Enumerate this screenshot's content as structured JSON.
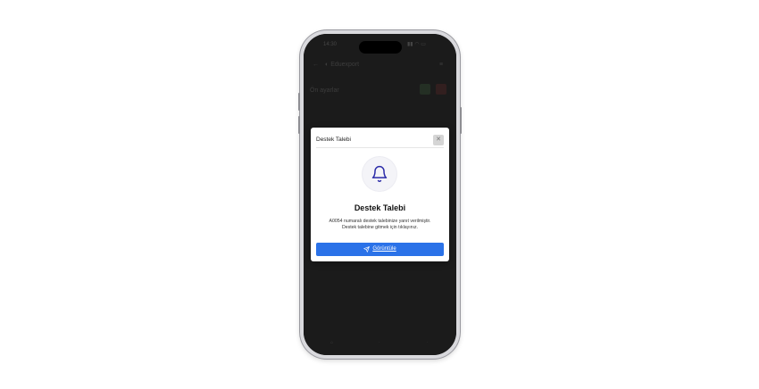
{
  "status_bar": {
    "time": "14:30"
  },
  "app_header": {
    "title": "Eduexport",
    "back_icon": "arrow-left-icon",
    "logo_icon": "logo-icon"
  },
  "background_row": {
    "label": "Ön ayarlar"
  },
  "modal": {
    "title": "Destek Talebi",
    "close_icon": "close-icon",
    "bell_icon": "bell-icon",
    "heading": "Destek Talebi",
    "message_line1": "A0054 numaralı destek talebinize yanıt verilmiştir.",
    "message_line2": "Destek talebine gitmek için tıklayınız.",
    "button_label": "Görüntüle",
    "button_icon": "send-icon",
    "accent_color": "#2b72e8",
    "icon_color": "#2b2ba8"
  }
}
